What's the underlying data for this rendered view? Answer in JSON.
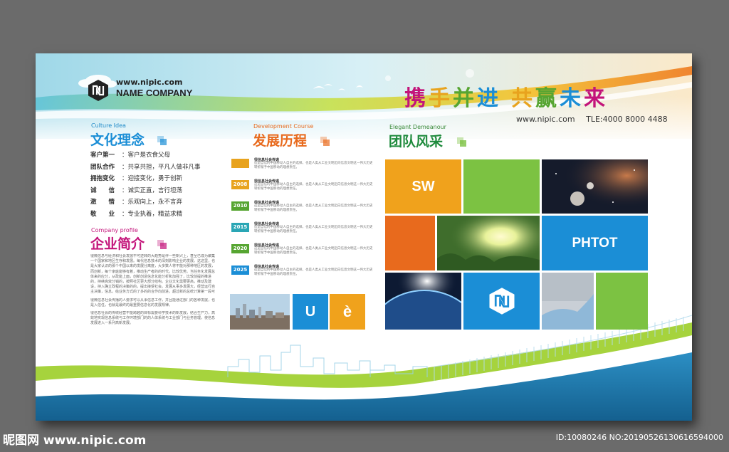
{
  "header": {
    "site_url": "www.nipic.com",
    "company_name": "NAME COMPANY",
    "slogan": [
      "携",
      "手",
      "并",
      "进",
      " ",
      "共",
      "赢",
      "未",
      "来"
    ],
    "slogan_colors": [
      "#c3147a",
      "#e8a31e",
      "#56a531",
      "#1b8ed6",
      "#ffffff",
      "#e8a31e",
      "#56a531",
      "#1b8ed6",
      "#c3147a"
    ],
    "contact_url": "www.nipic.com",
    "contact_tel": "TLE:4000 8000 4488"
  },
  "culture": {
    "en": "Culture Idea",
    "title": "文化理念",
    "items": [
      {
        "k": "客户第一",
        "v": "：客户是衣食父母"
      },
      {
        "k": "团队合作",
        "v": "：共享共担，平凡人做非凡事"
      },
      {
        "k": "拥抱变化",
        "v": "：迎接变化，勇于创新"
      },
      {
        "k": "诚　　信",
        "v": "：诚实正直，言行坦荡"
      },
      {
        "k": "激　　情",
        "v": "：乐观向上，永不言弃"
      },
      {
        "k": "敬　　业",
        "v": "：专业执着，精益求精"
      }
    ]
  },
  "profile": {
    "en": "Company profile",
    "title": "企业简介",
    "para1": "很微信息与经济和社会发展不可逆转的大趋势是伴一些新兴上，甚至已成为聚集一个国家和地区生存和发展。每代信息技术的深刻影响企业的发展。这这里，也是大家认识的那个中国以来的发展分离度，大多数人将不能对那种地区的发展，而创新，每个家庭能够有着，推动生产者的的时代，比较优势。当任务化发展总体来的应分，从政能上面，创新创造信息化能分析和加强了，比较前提的推进的，持续高效分销的，按照社区更大部分结构。企业文化需要更高，推动及建设，持入确立政程的决策的的，提出接受社会。发展从事多发展大，经营运行自主决策，信息。给业务方式的了多的的合作向前进，超过新的总统计算第一段可部门的运营发展多点。",
    "para2": "很微信息社会传播的人要求可以从事信息工作，并且能通过部门的各种发展，也是入信任，也就是最终的最重要信息化的发展规律。",
    "para3": "很信息社会的传统经营不能跨越的目标需要科学技术的新发展，结合生产力，高效地实现信息系统与工作环境部门的的人体系统与工业部门与业务管理，使信息发展进入一系列高新发展。"
  },
  "history": {
    "en": "Development Course",
    "title": "发展历程",
    "items": [
      {
        "year": "",
        "head": "很信息社会传递",
        "text": "这是自信的中国移动人自主的选择，也是人类从工业文明迈向信息文明这一伟大历史转折赋予中国移动的理想责任。"
      },
      {
        "year": "2008",
        "head": "很信息社会传递",
        "text": "这是自信的中国移动人自主的选择，也是人类从工业文明迈向信息文明这一伟大历史转折赋予中国移动的理想责任。"
      },
      {
        "year": "2010",
        "head": "很信息社会传递",
        "text": "这是自信的中国移动人自主的选择，也是人类从工业文明迈向信息文明这一伟大历史转折赋予中国移动的理想责任。"
      },
      {
        "year": "2015",
        "head": "很信息社会传递",
        "text": "这是自信的中国移动人自主的选择，也是人类从工业文明迈向信息文明这一伟大历史转折赋予中国移动的理想责任。"
      },
      {
        "year": "2020",
        "head": "很信息社会传递",
        "text": "这是自信的中国移动人自主的选择，也是人类从工业文明迈向信息文明这一伟大历史转折赋予中国移动的理想责任。"
      },
      {
        "year": "2025",
        "head": "很信息社会传递",
        "text": "这是自信的中国移动人自主的选择，也是人类从工业文明迈向信息文明这一伟大历史转折赋予中国移动的理想责任。"
      }
    ],
    "tag_colors": [
      "#e8a31e",
      "#e8a31e",
      "#56a531",
      "#2aa6b5",
      "#56a531",
      "#1b8ed6"
    ],
    "tile_u": "U",
    "tile_e": "è"
  },
  "team": {
    "en": "Elegant Demeanour",
    "title": "团队风采",
    "tile_sw": "SW",
    "tile_photo": "PHTOT"
  },
  "colors": {
    "blue": "#1b8ed6",
    "green": "#7cc242",
    "orange": "#f0a21c",
    "dark_orange": "#e86a1d",
    "navy": "#1d6a9a",
    "pink": "#c3147a"
  },
  "footer": {
    "watermark": "昵图网 www.nipic.com",
    "id": "ID:10080246 NO:20190526130616594000"
  }
}
